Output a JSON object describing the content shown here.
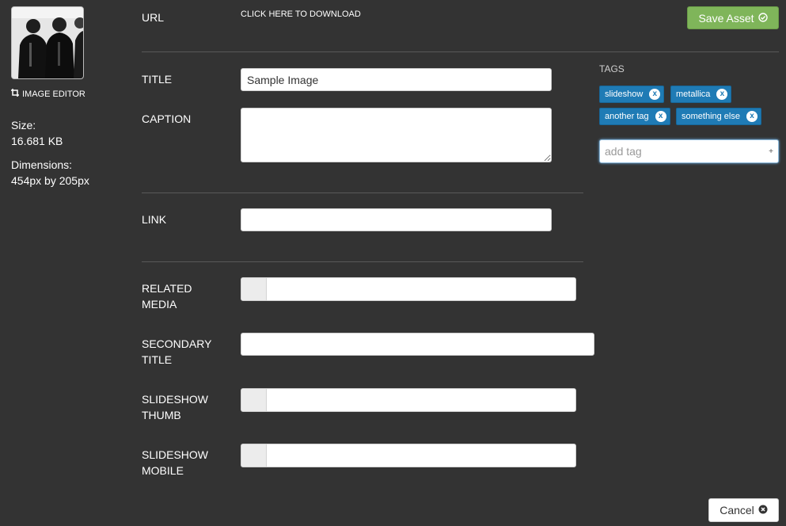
{
  "sidebar": {
    "image_editor_label": "IMAGE EDITOR",
    "size_label": "Size:",
    "size_value": "16.681 KB",
    "dimensions_label": "Dimensions:",
    "dimensions_value": "454px by 205px"
  },
  "form": {
    "url_label": "URL",
    "url_link": "CLICK HERE TO DOWNLOAD",
    "title_label": "TITLE",
    "title_value": "Sample Image",
    "caption_label": "CAPTION",
    "caption_value": "",
    "link_label": "LINK",
    "link_value": "",
    "related_label_1": "RELATED",
    "related_label_2": "MEDIA",
    "secondary_label_1": "SECONDARY",
    "secondary_label_2": "TITLE",
    "secondary_value": "",
    "thumb_label_1": "SLIDESHOW",
    "thumb_label_2": "THUMB",
    "mobile_label_1": "SLIDESHOW",
    "mobile_label_2": "MOBILE"
  },
  "actions": {
    "save_label": "Save Asset",
    "cancel_label": "Cancel"
  },
  "tags": {
    "title": "TAGS",
    "items": [
      {
        "label": "slideshow"
      },
      {
        "label": "metallica"
      },
      {
        "label": "another tag"
      },
      {
        "label": "something else"
      }
    ],
    "add_placeholder": "add tag",
    "add_symbol": "+"
  },
  "colors": {
    "background": "#333333",
    "save_button": "#7fb55a",
    "tag": "#1f7bb5"
  },
  "icons": {
    "save": "check-circle-icon",
    "cancel": "x-circle-icon",
    "image_editor": "crop-icon",
    "tag_remove": "x-circle-icon"
  }
}
